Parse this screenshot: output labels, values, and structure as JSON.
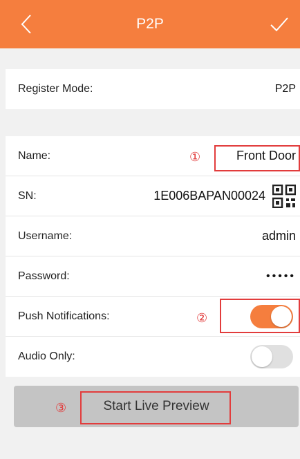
{
  "header": {
    "title": "P2P",
    "back_icon": "chevron-left-icon",
    "confirm_icon": "check-icon",
    "bg_color": "#f57e3e"
  },
  "register": {
    "label": "Register Mode:",
    "value": "P2P"
  },
  "fields": {
    "name": {
      "label": "Name:",
      "value": "Front Door",
      "callout": "①"
    },
    "sn": {
      "label": "SN:",
      "value": "1E006BAPAN00024",
      "icon": "qr-code-icon"
    },
    "username": {
      "label": "Username:",
      "value": "admin"
    },
    "password": {
      "label": "Password:",
      "value": "•••••"
    },
    "push": {
      "label": "Push Notifications:",
      "state": "on",
      "callout": "②"
    },
    "audio": {
      "label": "Audio Only:",
      "state": "off"
    }
  },
  "preview": {
    "label": "Start Live Preview",
    "callout": "③"
  },
  "colors": {
    "accent": "#f57e3e",
    "annotation": "#e23c3c"
  }
}
